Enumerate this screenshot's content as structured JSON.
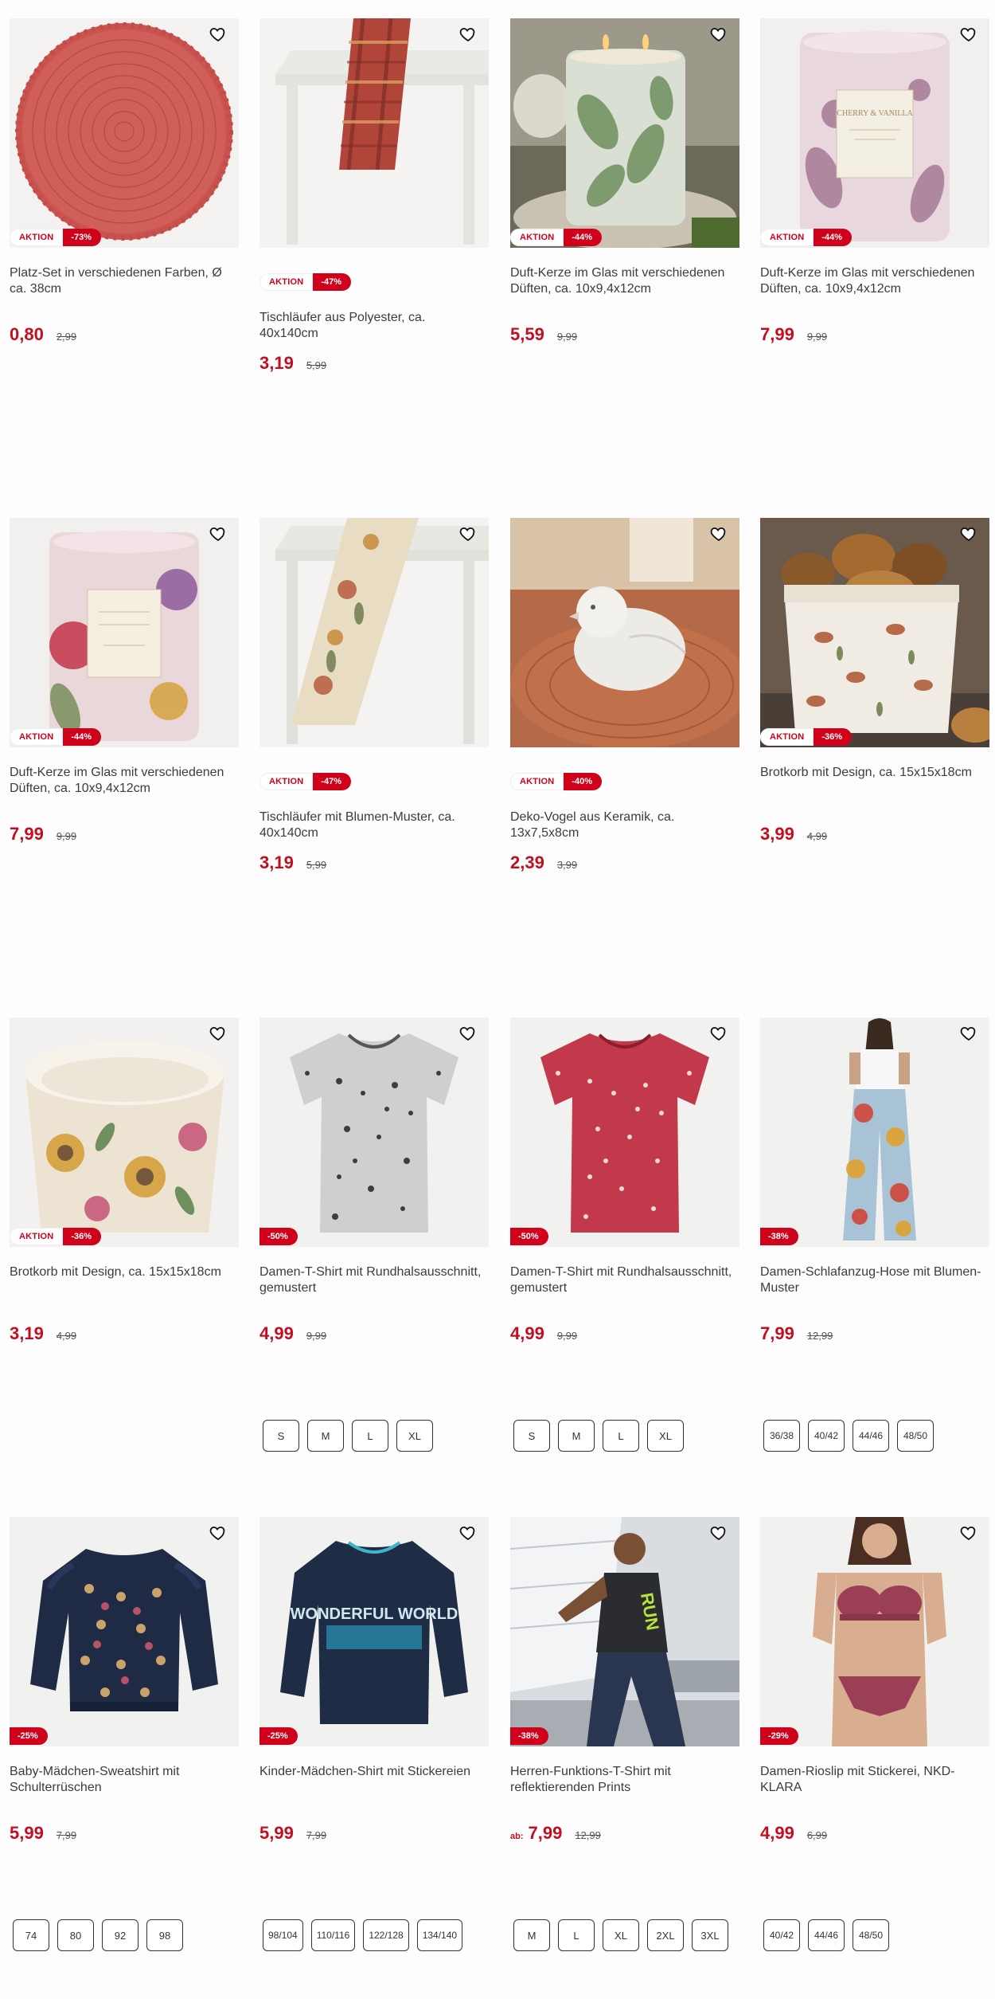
{
  "products": [
    {
      "title": "Platz-Set in verschiedenen Farben, Ø ca. 38cm",
      "aktion": "AKTION",
      "discount": "-73%",
      "price": "0,80",
      "old": "2,99",
      "img": "round-placemat"
    },
    {
      "title": "Tischläufer aus Polyester, ca. 40x140cm",
      "aktion": "AKTION",
      "discount": "-47%",
      "price": "3,19",
      "old": "5,99",
      "img": "table-runner-plaid"
    },
    {
      "title": "Duft-Kerze im Glas mit verschiedenen Düften, ca. 10x9,4x12cm",
      "aktion": "AKTION",
      "discount": "-44%",
      "price": "5,59",
      "old": "9,99",
      "img": "candle-green"
    },
    {
      "title": "Duft-Kerze im Glas mit verschiedenen Düften, ca. 10x9,4x12cm",
      "aktion": "AKTION",
      "discount": "-44%",
      "price": "7,99",
      "old": "9,99",
      "img": "candle-pink",
      "label": "CHERRY & VANILLA"
    },
    {
      "title": "Duft-Kerze im Glas mit verschiedenen Düften, ca. 10x9,4x12cm",
      "aktion": "AKTION",
      "discount": "-44%",
      "price": "7,99",
      "old": "9,99",
      "img": "candle-floral"
    },
    {
      "title": "Tischläufer mit Blumen-Muster, ca. 40x140cm",
      "aktion": "AKTION",
      "discount": "-47%",
      "price": "3,19",
      "old": "5,99",
      "img": "table-runner-floral"
    },
    {
      "title": "Deko-Vogel aus Keramik, ca. 13x7,5x8cm",
      "aktion": "AKTION",
      "discount": "-40%",
      "price": "2,39",
      "old": "3,99",
      "img": "ceramic-bird"
    },
    {
      "title": "Brotkorb mit Design, ca. 15x15x18cm",
      "aktion": "AKTION",
      "discount": "-36%",
      "price": "3,99",
      "old": "4,99",
      "img": "bread-basket-birds"
    },
    {
      "title": "Brotkorb mit Design, ca. 15x15x18cm",
      "aktion": "AKTION",
      "discount": "-36%",
      "price": "3,19",
      "old": "4,99",
      "img": "bread-basket-flowers"
    },
    {
      "title": "Damen-T-Shirt mit Rundhalsausschnitt, gemustert",
      "discount": "-50%",
      "price": "4,99",
      "old": "9,99",
      "img": "tshirt-grey",
      "sizes": [
        "S",
        "M",
        "L",
        "XL"
      ]
    },
    {
      "title": "Damen-T-Shirt mit Rundhalsausschnitt, gemustert",
      "discount": "-50%",
      "price": "4,99",
      "old": "9,99",
      "img": "tshirt-red",
      "sizes": [
        "S",
        "M",
        "L",
        "XL"
      ]
    },
    {
      "title": "Damen-Schlafanzug-Hose mit Blumen-Muster",
      "discount": "-38%",
      "price": "7,99",
      "old": "12,99",
      "img": "pajama-pants",
      "sizes": [
        "36/38",
        "40/42",
        "44/46",
        "48/50"
      ]
    },
    {
      "title": "Baby-Mädchen-Sweatshirt mit Schulterrüschen",
      "discount": "-25%",
      "price": "5,99",
      "old": "7,99",
      "img": "baby-sweatshirt",
      "sizes": [
        "74",
        "80",
        "92",
        "98"
      ]
    },
    {
      "title": "Kinder-Mädchen-Shirt mit Stickereien",
      "discount": "-25%",
      "price": "5,99",
      "old": "7,99",
      "img": "kids-shirt",
      "print": "WONDERFUL WORLD",
      "sizes": [
        "98/104",
        "110/116",
        "122/128",
        "134/140"
      ]
    },
    {
      "title": "Herren-Funktions-T-Shirt mit reflektierenden Prints",
      "discount": "-38%",
      "price": "7,99",
      "old": "12,99",
      "ab": "ab:",
      "img": "men-sport-shirt",
      "print": "RUN",
      "sizes": [
        "M",
        "L",
        "XL",
        "2XL",
        "3XL"
      ]
    },
    {
      "title": "Damen-Rioslip mit Stickerei, NKD-KLARA",
      "discount": "-29%",
      "price": "4,99",
      "old": "6,99",
      "img": "lingerie",
      "sizes": [
        "40/42",
        "44/46",
        "48/50"
      ]
    }
  ],
  "colors": {
    "accent": "#d0021b",
    "price": "#c40e1f"
  }
}
